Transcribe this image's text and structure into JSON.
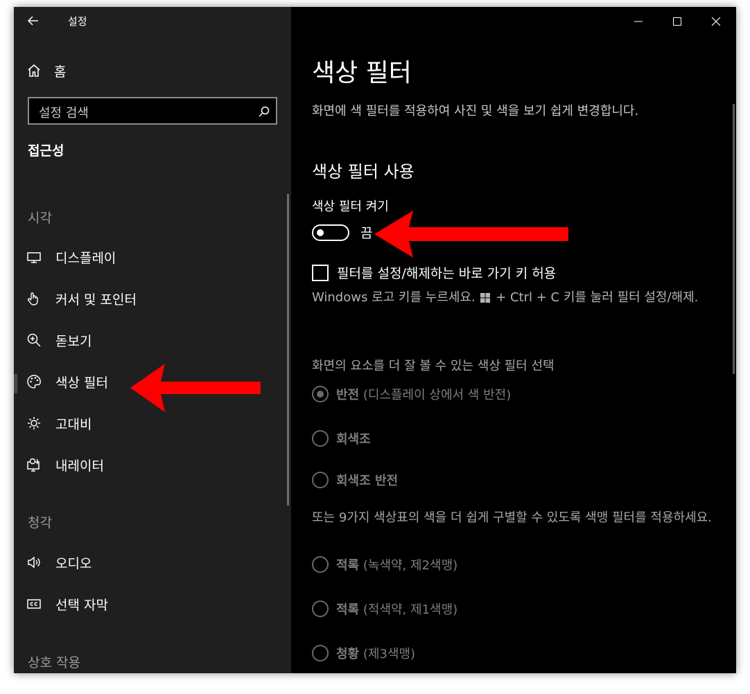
{
  "window": {
    "title": "설정"
  },
  "sidebar": {
    "home_label": "홈",
    "search_placeholder": "설정 검색",
    "section_title": "접근성",
    "groups": [
      {
        "label": "시각"
      },
      {
        "label": "청각"
      },
      {
        "label": "상호 작용"
      }
    ],
    "items": [
      {
        "label": "디스플레이",
        "icon": "monitor-icon"
      },
      {
        "label": "커서 및 포인터",
        "icon": "pointer-icon"
      },
      {
        "label": "돋보기",
        "icon": "magnifier-icon"
      },
      {
        "label": "색상 필터",
        "icon": "palette-icon",
        "selected": true
      },
      {
        "label": "고대비",
        "icon": "brightness-icon"
      },
      {
        "label": "내레이터",
        "icon": "narrator-icon"
      },
      {
        "label": "오디오",
        "icon": "speaker-icon"
      },
      {
        "label": "선택 자막",
        "icon": "closed-caption-icon"
      }
    ]
  },
  "main": {
    "title": "색상 필터",
    "description": "화면에 색 필터를 적용하여 사진 및 색을 보기 쉽게 변경합니다.",
    "subheading": "색상 필터 사용",
    "toggle": {
      "label": "색상 필터 켜기",
      "state": "끔",
      "on": false
    },
    "shortcut_checkbox": {
      "label": "필터를 설정/해제하는 바로 가기 키 허용",
      "checked": false
    },
    "shortcut_hint": {
      "before": "Windows 로고 키를 누르세요.",
      "after": "+ Ctrl + C 키를 눌러 필터 설정/해제."
    },
    "filter_question": "화면의 요소를 더 잘 볼 수 있는 색상 필터 선택",
    "filters": [
      {
        "name": "반전",
        "detail": "(디스플레이 상에서 색 반전)",
        "selected": true
      },
      {
        "name": "회색조",
        "detail": "",
        "selected": false
      },
      {
        "name": "회색조 반전",
        "detail": "",
        "selected": false
      }
    ],
    "colorblind_question": "또는 9가지 색상표의 색을 더 쉽게 구별할 수 있도록 색맹 필터를 적용하세요.",
    "colorblind_filters": [
      {
        "name": "적록",
        "detail": "(녹색약, 제2색맹)",
        "selected": false
      },
      {
        "name": "적록",
        "detail": "(적색약, 제1색맹)",
        "selected": false
      },
      {
        "name": "청황",
        "detail": "(제3색맹)",
        "selected": false
      }
    ]
  },
  "annotation_arrows": [
    {
      "target": "toggle-state",
      "color": "#ff0000"
    },
    {
      "target": "sidebar-item-color-filter",
      "color": "#ff0000"
    }
  ],
  "colors": {
    "sidebar_bg": "#1f1f1f",
    "main_bg": "#000000",
    "arrow": "#ff0000"
  }
}
